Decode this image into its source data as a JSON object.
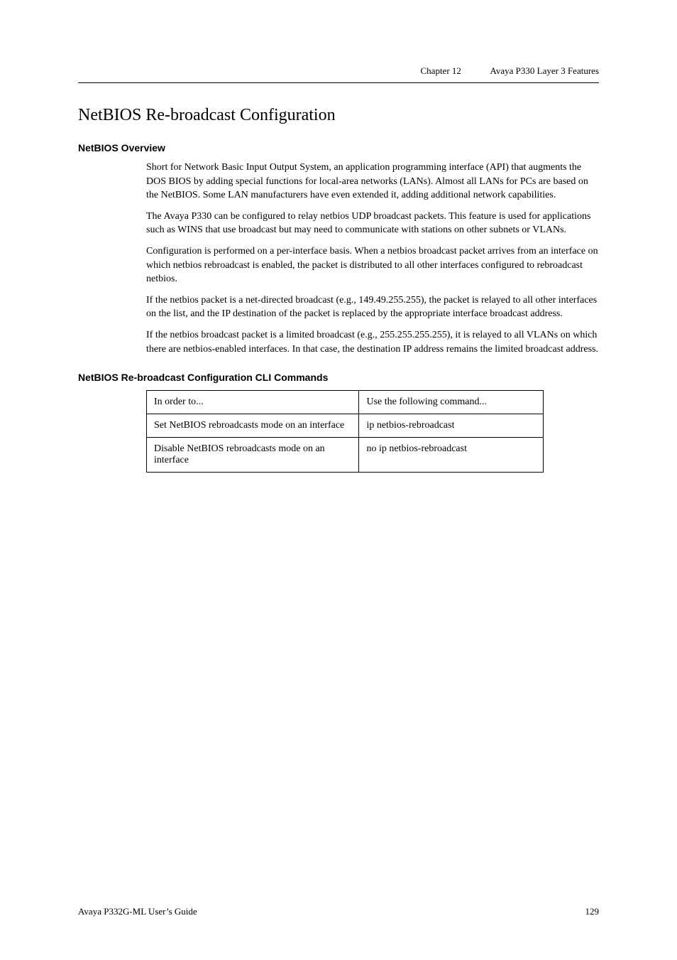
{
  "header": {
    "chapter_label": "Chapter 12",
    "chapter_title": "Avaya P330 Layer 3 Features"
  },
  "section_title": "NetBIOS Re-broadcast Configuration",
  "overview": {
    "heading": "NetBIOS Overview",
    "para1": "Short for Network Basic Input Output System, an application programming interface (API) that augments the DOS BIOS by adding special functions for local-area networks (LANs). Almost all LANs for PCs are based on the NetBIOS. Some LAN manufacturers have even extended it, adding additional network capabilities.",
    "para2": "The Avaya P330 can be configured to relay netbios UDP broadcast packets. This feature is used for applications such as WINS that use broadcast but may need to communicate with stations on other subnets or VLANs.",
    "para3": "Configuration is performed on a per-interface basis. When a netbios broadcast packet arrives from an interface on which netbios rebroadcast is enabled, the packet is distributed to all other interfaces configured to rebroadcast netbios.",
    "para4": "If the netbios packet is a net-directed broadcast (e.g., 149.49.255.255), the packet is relayed to all other interfaces on the list, and the IP destination of the packet is replaced by the appropriate interface broadcast address.",
    "para5": "If the netbios broadcast packet is a limited broadcast (e.g., 255.255.255.255), it is relayed to all VLANs on which there are netbios-enabled interfaces. In that case, the destination IP address remains the limited broadcast address."
  },
  "cli": {
    "heading": "NetBIOS Re-broadcast Configuration CLI Commands",
    "header_col1": "In order to...",
    "header_col2": "Use the following command...",
    "rows": [
      {
        "col1": "Set NetBIOS rebroadcasts mode on an interface",
        "col2": "ip netbios-rebroadcast"
      },
      {
        "col1": "Disable NetBIOS rebroadcasts mode on an interface",
        "col2": "no ip netbios-rebroadcast"
      }
    ]
  },
  "footer": {
    "text": "Avaya P332G-ML User’s Guide",
    "page": "129"
  }
}
